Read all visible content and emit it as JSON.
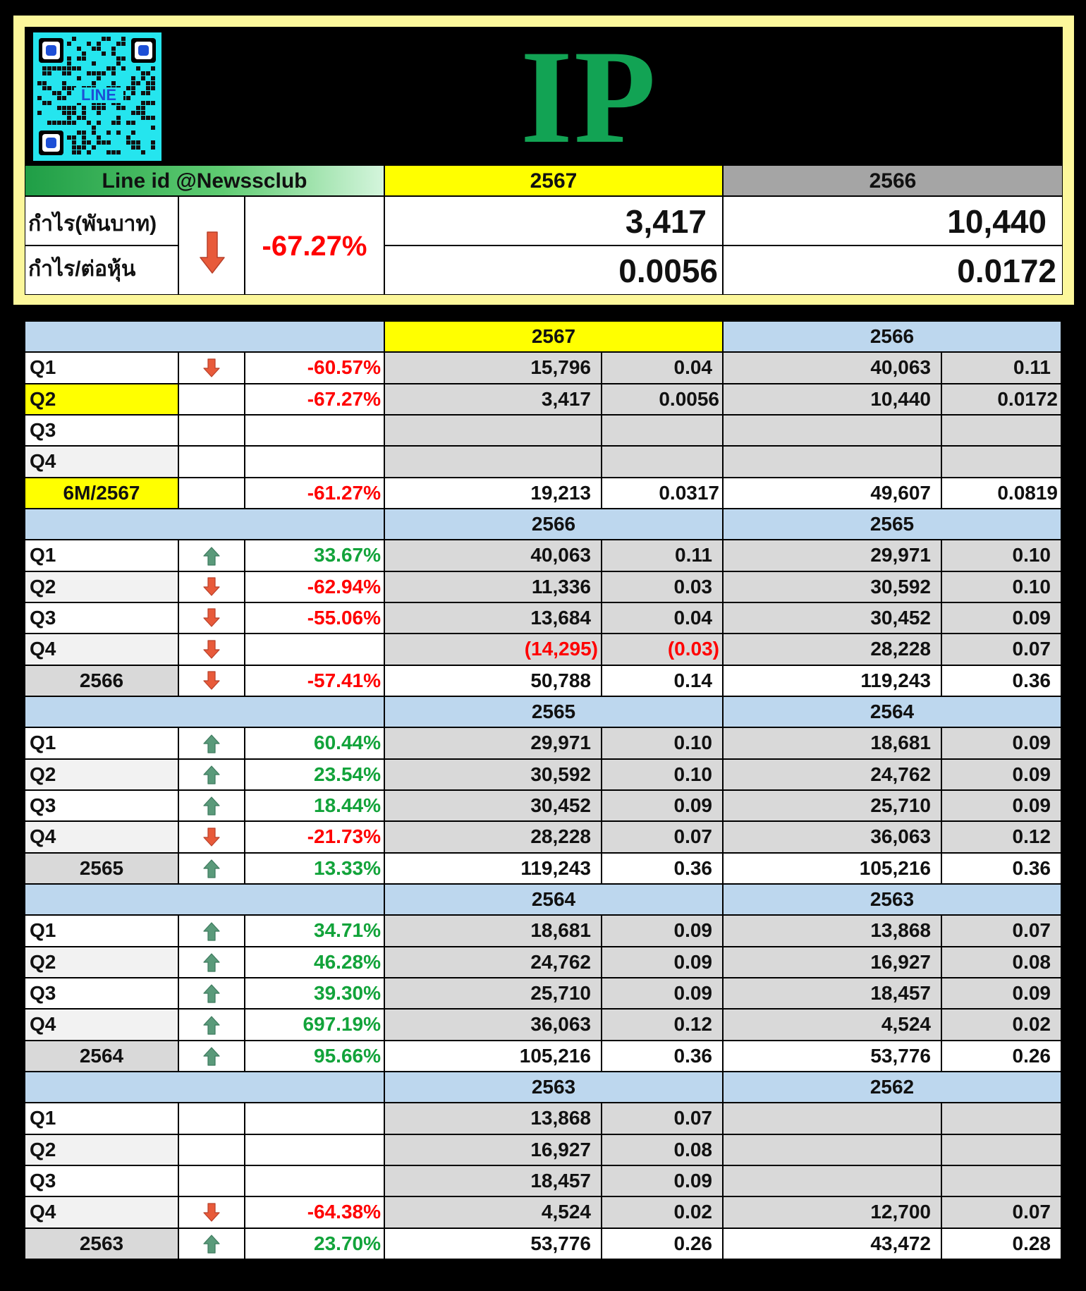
{
  "header": {
    "ticker": "IP",
    "qr_label": "LINE",
    "line_id": "Line id @Newssclub",
    "year_current": "2567",
    "year_previous": "2566",
    "profit_label": "กำไร(พันบาท)",
    "eps_label": "กำไร/ต่อหุ้น",
    "change": "-67.27%",
    "change_direction": "down",
    "profit_current": "3,417",
    "profit_previous": "10,440",
    "eps_current": "0.0056",
    "eps_previous": "0.0172"
  },
  "colors": {
    "green_up": "#5a9a7a",
    "red_down": "#e85a3a",
    "highlight": "#ffff00",
    "section_blue": "#bdd7ee"
  },
  "sections": [
    {
      "year_a": "2567",
      "year_b": "2566",
      "year_a_highlight": true,
      "rows": [
        {
          "label": "Q1",
          "dir": "down",
          "pct": "-60.57%",
          "a_profit": "15,796",
          "a_eps": "0.04",
          "b_profit": "40,063",
          "b_eps": "0.11"
        },
        {
          "label": "Q2",
          "dir": "",
          "pct": "-67.27%",
          "a_profit": "3,417",
          "a_eps": "0.0056",
          "b_profit": "10,440",
          "b_eps": "0.0172",
          "highlight": true
        },
        {
          "label": "Q3",
          "dir": "",
          "pct": "",
          "a_profit": "",
          "a_eps": "",
          "b_profit": "",
          "b_eps": ""
        },
        {
          "label": "Q4",
          "dir": "",
          "pct": "",
          "a_profit": "",
          "a_eps": "",
          "b_profit": "",
          "b_eps": ""
        },
        {
          "label": "6M/2567",
          "dir": "",
          "pct": "-61.27%",
          "a_profit": "19,213",
          "a_eps": "0.0317",
          "b_profit": "49,607",
          "b_eps": "0.0819",
          "total": true,
          "highlight": true
        }
      ]
    },
    {
      "year_a": "2566",
      "year_b": "2565",
      "rows": [
        {
          "label": "Q1",
          "dir": "up",
          "pct": "33.67%",
          "a_profit": "40,063",
          "a_eps": "0.11",
          "b_profit": "29,971",
          "b_eps": "0.10"
        },
        {
          "label": "Q2",
          "dir": "down",
          "pct": "-62.94%",
          "a_profit": "11,336",
          "a_eps": "0.03",
          "b_profit": "30,592",
          "b_eps": "0.10"
        },
        {
          "label": "Q3",
          "dir": "down",
          "pct": "-55.06%",
          "a_profit": "13,684",
          "a_eps": "0.04",
          "b_profit": "30,452",
          "b_eps": "0.09"
        },
        {
          "label": "Q4",
          "dir": "down",
          "pct": "",
          "a_profit": "(14,295)",
          "a_eps": "(0.03)",
          "b_profit": "28,228",
          "b_eps": "0.07",
          "a_negative": true
        },
        {
          "label": "2566",
          "dir": "down",
          "pct": "-57.41%",
          "a_profit": "50,788",
          "a_eps": "0.14",
          "b_profit": "119,243",
          "b_eps": "0.36",
          "total": true
        }
      ]
    },
    {
      "year_a": "2565",
      "year_b": "2564",
      "rows": [
        {
          "label": "Q1",
          "dir": "up",
          "pct": "60.44%",
          "a_profit": "29,971",
          "a_eps": "0.10",
          "b_profit": "18,681",
          "b_eps": "0.09"
        },
        {
          "label": "Q2",
          "dir": "up",
          "pct": "23.54%",
          "a_profit": "30,592",
          "a_eps": "0.10",
          "b_profit": "24,762",
          "b_eps": "0.09"
        },
        {
          "label": "Q3",
          "dir": "up",
          "pct": "18.44%",
          "a_profit": "30,452",
          "a_eps": "0.09",
          "b_profit": "25,710",
          "b_eps": "0.09"
        },
        {
          "label": "Q4",
          "dir": "down",
          "pct": "-21.73%",
          "a_profit": "28,228",
          "a_eps": "0.07",
          "b_profit": "36,063",
          "b_eps": "0.12"
        },
        {
          "label": "2565",
          "dir": "up",
          "pct": "13.33%",
          "a_profit": "119,243",
          "a_eps": "0.36",
          "b_profit": "105,216",
          "b_eps": "0.36",
          "total": true
        }
      ]
    },
    {
      "year_a": "2564",
      "year_b": "2563",
      "rows": [
        {
          "label": "Q1",
          "dir": "up",
          "pct": "34.71%",
          "a_profit": "18,681",
          "a_eps": "0.09",
          "b_profit": "13,868",
          "b_eps": "0.07"
        },
        {
          "label": "Q2",
          "dir": "up",
          "pct": "46.28%",
          "a_profit": "24,762",
          "a_eps": "0.09",
          "b_profit": "16,927",
          "b_eps": "0.08"
        },
        {
          "label": "Q3",
          "dir": "up",
          "pct": "39.30%",
          "a_profit": "25,710",
          "a_eps": "0.09",
          "b_profit": "18,457",
          "b_eps": "0.09"
        },
        {
          "label": "Q4",
          "dir": "up",
          "pct": "697.19%",
          "a_profit": "36,063",
          "a_eps": "0.12",
          "b_profit": "4,524",
          "b_eps": "0.02"
        },
        {
          "label": "2564",
          "dir": "up",
          "pct": "95.66%",
          "a_profit": "105,216",
          "a_eps": "0.36",
          "b_profit": "53,776",
          "b_eps": "0.26",
          "total": true
        }
      ]
    },
    {
      "year_a": "2563",
      "year_b": "2562",
      "rows": [
        {
          "label": "Q1",
          "dir": "",
          "pct": "",
          "a_profit": "13,868",
          "a_eps": "0.07",
          "b_profit": "",
          "b_eps": ""
        },
        {
          "label": "Q2",
          "dir": "",
          "pct": "",
          "a_profit": "16,927",
          "a_eps": "0.08",
          "b_profit": "",
          "b_eps": ""
        },
        {
          "label": "Q3",
          "dir": "",
          "pct": "",
          "a_profit": "18,457",
          "a_eps": "0.09",
          "b_profit": "",
          "b_eps": ""
        },
        {
          "label": "Q4",
          "dir": "down",
          "pct": "-64.38%",
          "a_profit": "4,524",
          "a_eps": "0.02",
          "b_profit": "12,700",
          "b_eps": "0.07"
        },
        {
          "label": "2563",
          "dir": "up",
          "pct": "23.70%",
          "a_profit": "53,776",
          "a_eps": "0.26",
          "b_profit": "43,472",
          "b_eps": "0.28",
          "total": true
        }
      ]
    }
  ]
}
